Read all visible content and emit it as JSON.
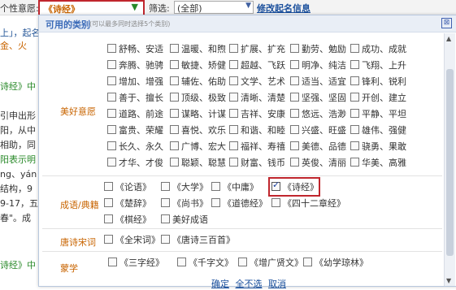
{
  "topbar": {
    "label": "个性意愿:",
    "main_select": "《诗经》",
    "filter_label": "筛选:",
    "filter_value": "(全部)",
    "modify_link": "修改起名信息"
  },
  "background": {
    "lines": [
      "上」，起名",
      "金、火",
      "诗经》中",
      "引申出形",
      "阳，从中",
      "相助，同",
      "阳表示明",
      "ng、yán",
      "结构，9",
      "9-17，五",
      "春\"。成",
      "诗经》中"
    ]
  },
  "dialog": {
    "title": "可用的类别",
    "hint": "(可以最多同时选择5个类别)",
    "close": "⊠",
    "categories": [
      {
        "label": "美好意愿",
        "rows": [
          [
            "舒畅、安适",
            "温暖、和煦",
            "扩展、扩充",
            "勤劳、勉励",
            "成功、成就"
          ],
          [
            "奔腾、驰骋",
            "敏捷、矫健",
            "超越、飞跃",
            "明净、纯洁",
            "飞翔、上升"
          ],
          [
            "增加、增强",
            "辅佐、佑助",
            "文学、艺术",
            "适当、适宜",
            "锋利、锐利"
          ],
          [
            "善于、擅长",
            "顶级、极致",
            "清晰、清楚",
            "坚强、坚固",
            "开创、建立"
          ],
          [
            "道路、前途",
            "谋略、计谋",
            "吉祥、安康",
            "悠远、浩渺",
            "平静、平坦"
          ],
          [
            "富贵、荣耀",
            "喜悦、欢乐",
            "和谐、和睦",
            "兴盛、旺盛",
            "雄伟、强健"
          ],
          [
            "长久、永久",
            "广博、宏大",
            "福祥、寿禧",
            "美德、品德",
            "骁勇、果敢"
          ],
          [
            "才华、才俊",
            "聪颖、聪慧",
            "财富、钱币",
            "英俊、清丽",
            "华美、高雅"
          ]
        ]
      },
      {
        "label": "成语/典籍",
        "rows": [
          [
            "《论语》",
            "《大学》",
            "《中庸》",
            "《诗经》"
          ],
          [
            "《楚辞》",
            "《尚书》",
            "《道德经》",
            "《四十二章经》"
          ],
          [
            "《棋经》",
            "美好成语"
          ]
        ]
      },
      {
        "label": "唐诗宋词",
        "rows": [
          [
            "《全宋词》",
            "《唐诗三百首》"
          ]
        ]
      },
      {
        "label": "蒙学",
        "rows": [
          [
            "《三字经》",
            "《千字文》",
            "《增广贤文》",
            "《幼学琼林》"
          ]
        ]
      }
    ],
    "checked": "《诗经》",
    "actions": {
      "ok": "确定",
      "clear": "全不选",
      "cancel": "取消"
    }
  },
  "colors": {
    "accent": "#c86400",
    "highlight": "#c0262d",
    "link": "#1a4f9c"
  }
}
